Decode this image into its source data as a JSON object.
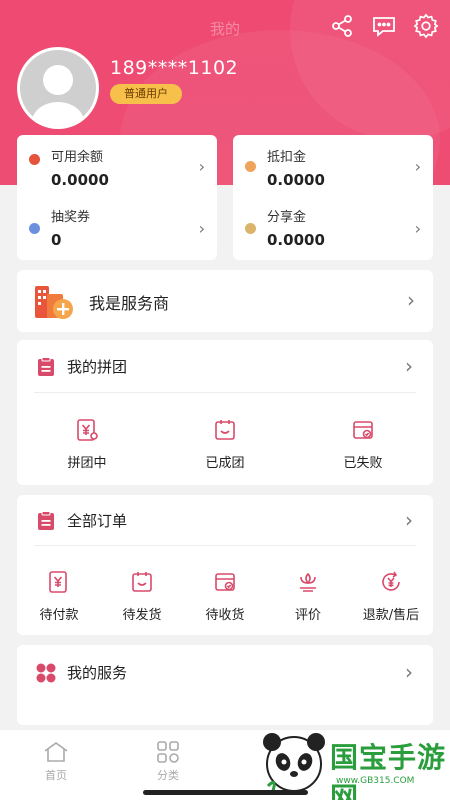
{
  "header": {
    "title": "我的",
    "phone": "189****1102",
    "badge": "普通用户"
  },
  "balances": [
    {
      "label": "可用余额",
      "value": "0.0000",
      "dot_color": "#e5533d"
    },
    {
      "label": "抵扣金",
      "value": "0.0000",
      "dot_color": "#f0a35b"
    },
    {
      "label": "抽奖券",
      "value": "0",
      "dot_color": "#6d8fe0"
    },
    {
      "label": "分享金",
      "value": "0.0000",
      "dot_color": "#d9b46a"
    }
  ],
  "provider": {
    "label": "我是服务商"
  },
  "group": {
    "title": "我的拼团",
    "items": [
      {
        "label": "拼团中",
        "icon": "yen-card-icon"
      },
      {
        "label": "已成团",
        "icon": "group-done-icon"
      },
      {
        "label": "已失败",
        "icon": "group-failed-icon"
      }
    ]
  },
  "orders": {
    "title": "全部订单",
    "items": [
      {
        "label": "待付款",
        "icon": "wallet-yen-icon"
      },
      {
        "label": "待发货",
        "icon": "package-icon"
      },
      {
        "label": "待收货",
        "icon": "delivery-box-icon"
      },
      {
        "label": "评价",
        "icon": "flower-icon"
      },
      {
        "label": "退款/售后",
        "icon": "refund-icon"
      }
    ]
  },
  "services": {
    "title": "我的服务"
  },
  "tabbar": [
    {
      "label": "首页",
      "icon": "home-icon"
    },
    {
      "label": "分类",
      "icon": "category-icon"
    }
  ],
  "watermark": {
    "text": "国宝手游网",
    "url": "www.GB315.COM"
  },
  "colors": {
    "brand": "#ee4d73",
    "accent_pink": "#d94a6a",
    "badge": "#f6c04b"
  }
}
